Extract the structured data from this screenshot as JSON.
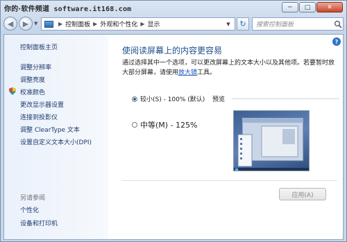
{
  "watermark": {
    "cn": "你的·软件频道",
    "url": "software.it168.com"
  },
  "window": {
    "minimize": "─",
    "maximize": "□",
    "close": "✕"
  },
  "toolbar": {
    "back_glyph": "◀",
    "forward_glyph": "▶",
    "nav_drop": "▼",
    "breadcrumb": [
      "控制面板",
      "外观和个性化",
      "显示"
    ],
    "breadcrumb_sep": "▶",
    "address_drop": "▼",
    "refresh_glyph": "↻",
    "search_placeholder": "搜索控制面板",
    "search_icon": "search-icon"
  },
  "sidebar": {
    "home": "控制面板主页",
    "items": [
      "调整分辨率",
      "调整亮度",
      "校准颜色",
      "更改显示器设置",
      "连接到投影仪",
      "调整 ClearType 文本",
      "设置自定义文本大小(DPI)"
    ],
    "see_also_header": "另请参阅",
    "see_also": [
      "个性化",
      "设备和打印机"
    ]
  },
  "main": {
    "help": "?",
    "title": "使阅读屏幕上的内容更容易",
    "desc_part1": "通过选择其中一个选项，可以更改屏幕上的文本大小以及其他项。若要暂时放大部分屏幕，请使用",
    "desc_link": "放大镜",
    "desc_part2": "工具。",
    "options": [
      {
        "label": "较小(S) - 100% (默认)",
        "selected": true
      },
      {
        "label": "中等(M) - 125%",
        "selected": false
      }
    ],
    "preview_label": "预览",
    "apply_label": "应用(A)"
  }
}
